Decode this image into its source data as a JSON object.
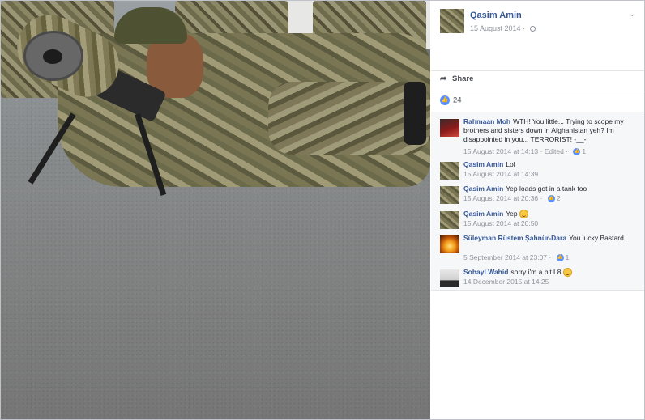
{
  "post": {
    "poster_name": "Qasim Amin",
    "date": "15 August 2014 · ",
    "privacy_icon": "globe-icon",
    "menu_icon": "chevron-down-icon"
  },
  "actions": {
    "share_label": "Share",
    "share_icon": "share-arrow-icon"
  },
  "reactions": {
    "like_icon": "thumbs-up-icon",
    "like_count": "24"
  },
  "comments": [
    {
      "name": "Rahmaan Moh",
      "text": "WTH! You little... Trying to scope my brothers and sisters down in Afghanistan yeh? Im disappointed in you... TERRORIST! -__-",
      "time": "15 August 2014 at 14:13 · Edited · ",
      "likes": "1",
      "avatar_color": "#8a1b1b"
    },
    {
      "name": "Qasim Amin",
      "text": "Lol",
      "time": "15 August 2014 at 14:39",
      "likes": ""
    },
    {
      "name": "Qasim Amin",
      "text": "Yep loads got in a tank too",
      "time": "15 August 2014 at 20:36 · ",
      "likes": "2"
    },
    {
      "name": "Qasim Amin",
      "text": "Yep",
      "time": "15 August 2014 at 20:50",
      "likes": "",
      "emoji": "laughing-emoji-icon"
    },
    {
      "name": "Süleyman Rüstem Şahnür-Dara",
      "text": "You lucky Bastard.",
      "time": "5 September 2014 at 23:07 · ",
      "likes": "1",
      "avatar_color": "#f39b1b"
    },
    {
      "name": "Sohayl Wahid",
      "text": "sorry i'm a bit L8",
      "time": "14 December 2015 at 14:25",
      "likes": "",
      "emoji": "smile-emoji-icon"
    }
  ],
  "colors": {
    "link_blue": "#365899",
    "like_blue": "#5890ff",
    "meta_gray": "#90949c",
    "comment_bg": "#f6f7f9"
  }
}
